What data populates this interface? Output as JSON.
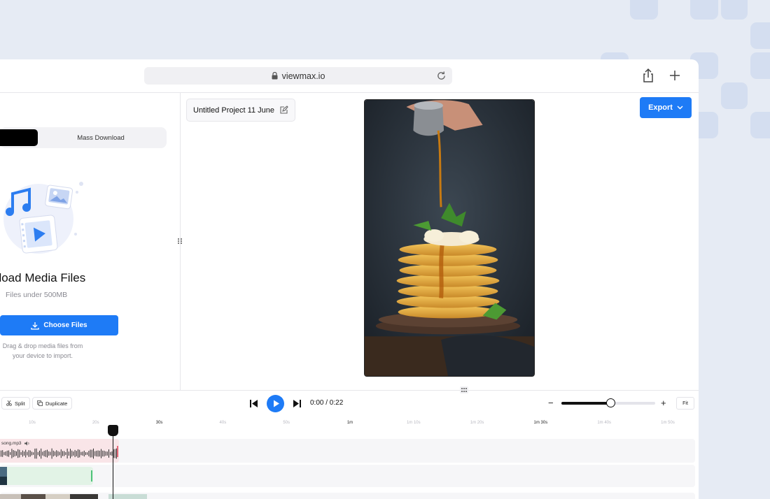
{
  "browser": {
    "url": "viewmax.io"
  },
  "sidebar": {
    "tabs": [
      {
        "label": "",
        "active": true
      },
      {
        "label": "Mass Download",
        "active": false
      }
    ],
    "upload": {
      "title": "pload Media Files",
      "subtitle": "Files under 500MB",
      "button_label": "Choose Files",
      "hint": "Drag & drop media files from your device to import."
    }
  },
  "editor": {
    "project_title": "Untitled Project 11 June",
    "export_label": "Export"
  },
  "controls": {
    "split_label": "Split",
    "duplicate_label": "Duplicate",
    "time_display": "0:00 / 0:22",
    "zoom_level": 0.52,
    "fit_label": "Fit"
  },
  "ruler": {
    "ticks": [
      "10s",
      "20s",
      "30s",
      "40s",
      "50s",
      "1m",
      "1m 10s",
      "1m 20s",
      "1m 30s",
      "1m 40s",
      "1m 50s"
    ],
    "major": [
      "30s",
      "1m",
      "1m 30s"
    ]
  },
  "timeline": {
    "audio_clip_name": "song.mp3"
  },
  "colors": {
    "accent": "#1e7bf6",
    "audio_clip": "#f9e5e8",
    "video_clip": "#e2f3e6"
  },
  "icons": [
    "lock-icon",
    "reload-icon",
    "share-icon",
    "plus-icon",
    "edit-icon",
    "chevron-down-icon",
    "download-icon",
    "scissors-icon",
    "duplicate-icon",
    "skip-back-icon",
    "play-icon",
    "skip-forward-icon",
    "volume-icon",
    "drag-handle-icon"
  ]
}
